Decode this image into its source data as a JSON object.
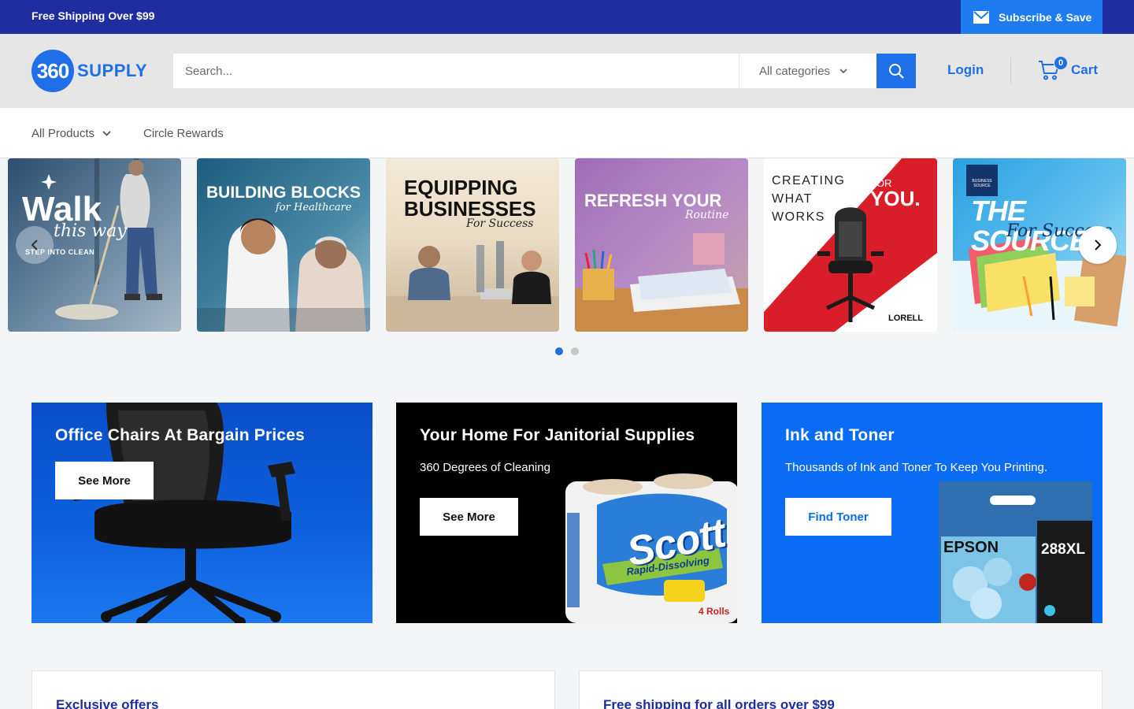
{
  "announcement": {
    "text": "Free Shipping Over $99",
    "subscribe_label": "Subscribe & Save"
  },
  "header": {
    "logo_number": "360",
    "logo_word": "SUPPLY",
    "search_placeholder": "Search...",
    "category_selected": "All categories",
    "login_label": "Login",
    "cart_label": "Cart",
    "cart_count": "0"
  },
  "nav": {
    "items": [
      {
        "label": "All Products"
      },
      {
        "label": "Circle Rewards"
      }
    ]
  },
  "carousel": {
    "slides": [
      {
        "title": "Walk",
        "script": "this way",
        "tagline": "STEP INTO CLEAN"
      },
      {
        "title": "BUILDING BLOCKS",
        "script": "for Healthcare"
      },
      {
        "title_line1": "EQUIPPING",
        "title_line2": "BUSINESSES",
        "script": "For Success"
      },
      {
        "title": "REFRESH YOUR",
        "script": "Routine"
      },
      {
        "line1": "CREATING",
        "line2": "WHAT",
        "line3": "WORKS",
        "for": "FOR",
        "you": "YOU.",
        "brand": "LORELL"
      },
      {
        "title": "THE SOURCE",
        "script": "For Success",
        "badge_line1": "BUSINESS",
        "badge_line2": "SOURCE"
      }
    ],
    "active_dot": 0,
    "dot_count": 2
  },
  "promos": [
    {
      "title": "Office Chairs At Bargain Prices",
      "button": "See More"
    },
    {
      "title": "Your Home For Janitorial Supplies",
      "subtitle": "360 Degrees of Cleaning",
      "button": "See More",
      "brand": "Scott",
      "product": "Rapid-Dissolving",
      "rolls": "4 Rolls"
    },
    {
      "title": "Ink and Toner",
      "subtitle": "Thousands of Ink and Toner To Keep You Printing.",
      "button": "Find Toner",
      "brand": "EPSON",
      "model": "288XL"
    }
  ],
  "info_cards": [
    {
      "title": "Exclusive offers"
    },
    {
      "title": "Free shipping for all orders over $99"
    }
  ],
  "colors": {
    "primary": "#1e6fe8",
    "navy": "#1e2d9f",
    "header_bg": "#e6e6e6"
  }
}
